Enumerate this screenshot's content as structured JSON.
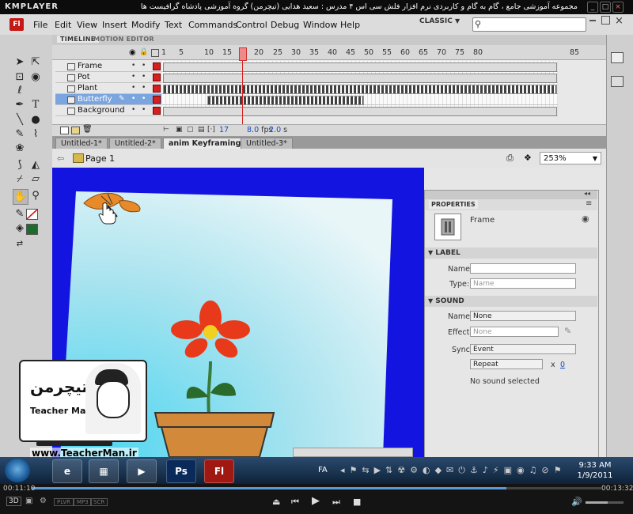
{
  "kmplayer": {
    "logo": "KMPLAYER",
    "title": "مجموعه آموزشی جامع ، گام به گام و کاربردی نرم افزار فلش سی اس ۴ مدرس : سعید هدایی (تیچرمن) گروه آموزشی پادشاه گرافیست ها"
  },
  "flash": {
    "logo": "Fl",
    "menu": [
      "File",
      "Edit",
      "View",
      "Insert",
      "Modify",
      "Text",
      "Commands",
      "Control",
      "Debug",
      "Window",
      "Help"
    ],
    "workspace": "CLASSIC",
    "search_placeholder": ""
  },
  "timeline": {
    "tabs": [
      "TIMELINE",
      "MOTION EDITOR"
    ],
    "frame_numbers": [
      "1",
      "5",
      "10",
      "15",
      "20",
      "25",
      "30",
      "35",
      "40",
      "45",
      "50",
      "55",
      "60",
      "65",
      "70",
      "75",
      "80",
      "85"
    ],
    "layers": [
      "Frame",
      "Pot",
      "Plant",
      "Butterfly",
      "Background"
    ],
    "selected_layer": "Butterfly",
    "current_frame": "17",
    "fps": "8.0",
    "fps_unit": "fps",
    "time": "2.0",
    "time_unit": "s"
  },
  "documents": {
    "tabs": [
      "Untitled-1*",
      "Untitled-2*",
      "anim Keyframing*",
      "Untitled-3*"
    ],
    "active": "anim Keyframing*",
    "scene": "Page 1",
    "zoom": "253%"
  },
  "properties": {
    "tab": "PROPERTIES",
    "type": "Frame",
    "label_section": "LABEL",
    "name_label": "Name:",
    "type_label": "Type:",
    "type_value": "Name",
    "sound_section": "SOUND",
    "sound_name_label": "Name:",
    "sound_name_value": "None",
    "effect_label": "Effect:",
    "effect_value": "None",
    "sync_label": "Sync:",
    "sync_value": "Event",
    "repeat_value": "Repeat",
    "repeat_x": "x",
    "repeat_count": "0",
    "status": "No sound selected"
  },
  "watermark": {
    "site": "www.TeacherMan.ir",
    "logo_text": "TeacherMan.ir",
    "badge_name": "Teacher Man",
    "badge_fa": "تیچرمن"
  },
  "taskbar": {
    "lang": "FA",
    "time": "9:33 AM",
    "date": "1/9/2011",
    "apps": [
      "Ps",
      "Fl"
    ]
  },
  "player": {
    "elapsed": "00:11:10",
    "total": "00:13:32",
    "mode": "3D",
    "mini_buttons": [
      "PLVR",
      "MP3",
      "SCR"
    ]
  },
  "colors": {
    "frame_blue": "#1414e0",
    "flower_red": "#e83a1a",
    "pot_orange": "#d28a3a",
    "butterfly": "#e88a2a",
    "layer_selected": "#7ba5df"
  }
}
